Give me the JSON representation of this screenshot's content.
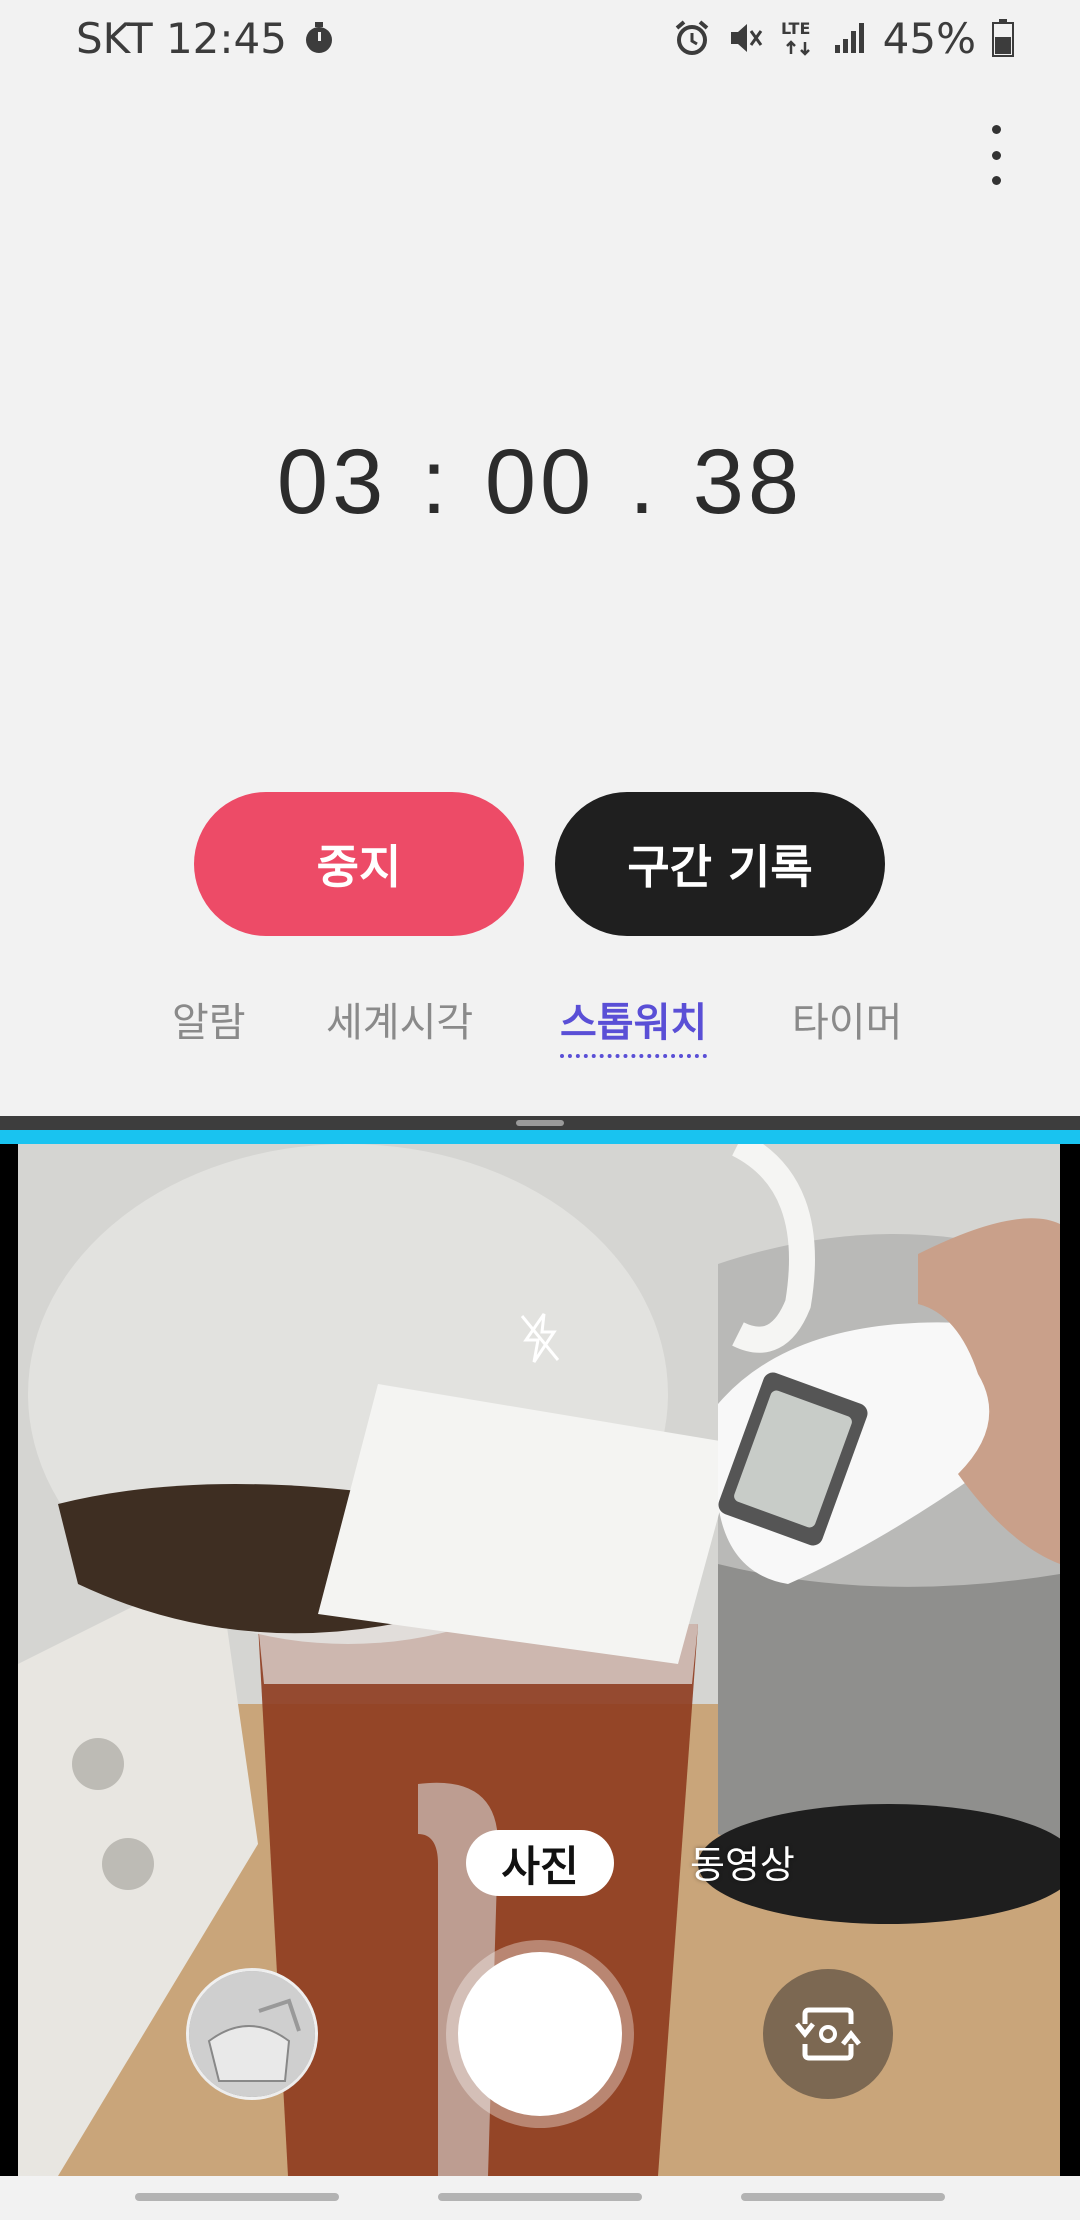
{
  "status": {
    "carrier_time": "SKT 12:45",
    "battery": "45%",
    "network": "LTE"
  },
  "stopwatch": {
    "minutes": "03",
    "colon": ":",
    "seconds": "00",
    "dot": ".",
    "hundredths": "38"
  },
  "buttons": {
    "stop_label": "중지",
    "lap_label": "구간 기록"
  },
  "tabs": [
    {
      "label": "알람",
      "active": false
    },
    {
      "label": "세계시각",
      "active": false
    },
    {
      "label": "스톱워치",
      "active": true
    },
    {
      "label": "타이머",
      "active": false
    }
  ],
  "camera": {
    "modes": {
      "photo": "사진",
      "video": "동영상"
    },
    "flash": "off"
  },
  "colors": {
    "stop_button": "#ed4b67",
    "lap_button": "#1f1f1f",
    "active_tab": "#5a4fd6",
    "split_accent": "#19c3f0"
  }
}
